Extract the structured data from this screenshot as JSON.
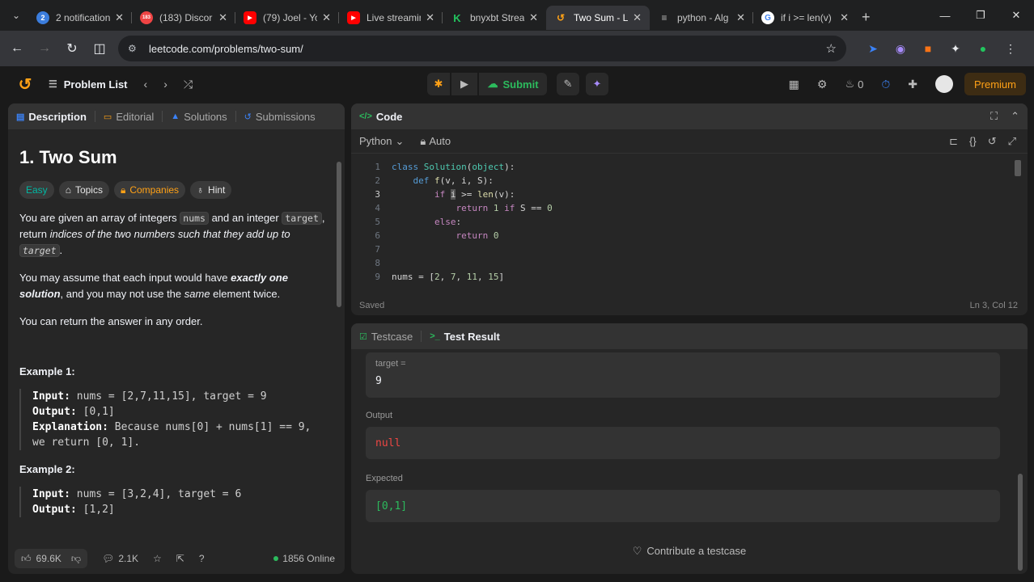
{
  "browser": {
    "tabs": [
      {
        "title": "2 notification",
        "favicon_color": "#3b7ddd",
        "favicon_glyph": "2"
      },
      {
        "title": "(183) Discor",
        "favicon_color": "#ef4444",
        "favicon_glyph": "183"
      },
      {
        "title": "(79) Joel - Yo",
        "favicon_color": "#ff0000",
        "favicon_glyph": "▶"
      },
      {
        "title": "Live streamin",
        "favicon_color": "#ff0000",
        "favicon_glyph": "▶"
      },
      {
        "title": "bnyxbt Strea",
        "favicon_color": "#22c55e",
        "favicon_glyph": "K"
      },
      {
        "title": "Two Sum - L",
        "favicon_color": "#ffa116",
        "favicon_glyph": "↺"
      },
      {
        "title": "python - Alg",
        "favicon_color": "#9ca3af",
        "favicon_glyph": "≡"
      },
      {
        "title": "if i >= len(v)",
        "favicon_color": "#4285f4",
        "favicon_glyph": "G"
      }
    ],
    "active_tab_index": 5,
    "url": "leetcode.com/problems/two-sum/"
  },
  "header": {
    "problem_list_label": "Problem List",
    "submit_label": "Submit",
    "streak_count": "0",
    "premium_label": "Premium"
  },
  "left_panel": {
    "tabs": [
      "Description",
      "Editorial",
      "Solutions",
      "Submissions"
    ],
    "title": "1. Two Sum",
    "chips": [
      "Easy",
      "Topics",
      "Companies",
      "Hint"
    ],
    "para1": {
      "a": "You are given an array of integers ",
      "code1": "nums",
      "b": " and an integer ",
      "code2": "target",
      "c": ", return ",
      "em": "indices of the two numbers such that they add up to",
      "code3": "target",
      "d": "."
    },
    "para2": {
      "a": "You may assume that each input would have ",
      "strong": "exactly one solution",
      "b": ", and you may not use the ",
      "em": "same",
      "c": " element twice."
    },
    "para3": "You can return the answer in any order.",
    "example1": {
      "title": "Example 1:",
      "input_label": "Input:",
      "input": "nums = [2,7,11,15], target = 9",
      "output_label": "Output:",
      "output": "[0,1]",
      "explanation_label": "Explanation:",
      "explanation_1": "Because nums[0] + nums[1] == 9,",
      "explanation_2": "we return [0, 1]."
    },
    "example2": {
      "title": "Example 2:",
      "input_label": "Input:",
      "input": "nums = [3,2,4], target = 6",
      "output_label": "Output:",
      "output": "[1,2]"
    },
    "footer": {
      "likes": "69.6K",
      "comments": "2.1K",
      "online": "1856 Online"
    }
  },
  "code_panel": {
    "title": "Code",
    "language": "Python",
    "mode": "Auto",
    "status": "Saved",
    "cursor": "Ln 3, Col 12",
    "line_numbers": [
      "1",
      "2",
      "3",
      "4",
      "5",
      "6",
      "7",
      "8",
      "9"
    ]
  },
  "result_panel": {
    "tabs": [
      "Testcase",
      "Test Result"
    ],
    "target_label": "target =",
    "target_value": "9",
    "output_label": "Output",
    "output_value": "null",
    "expected_label": "Expected",
    "expected_value": "[0,1]",
    "contribute_label": "Contribute a testcase"
  }
}
